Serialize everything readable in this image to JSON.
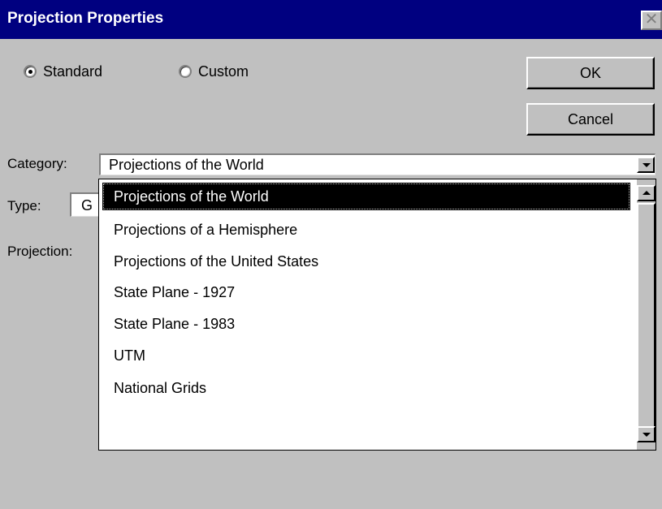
{
  "window": {
    "title": "Projection Properties",
    "close_glyph": "✕"
  },
  "mode": {
    "options": [
      {
        "label": "Standard",
        "checked": true
      },
      {
        "label": "Custom",
        "checked": false
      }
    ]
  },
  "buttons": {
    "ok": "OK",
    "cancel": "Cancel"
  },
  "category": {
    "label": "Category:",
    "value": "Projections of the World",
    "options": [
      "Projections of the World",
      "Projections of a Hemisphere",
      "Projections of the United States",
      "State Plane - 1927",
      "State Plane - 1983",
      "UTM",
      "National Grids"
    ],
    "selected_index": 0
  },
  "type": {
    "label": "Type:",
    "value": "G"
  },
  "projection": {
    "label": "Projection:"
  },
  "icons": {
    "close": "close-icon",
    "dropdown_arrow": "chevron-down-icon",
    "scroll_up": "scroll-up-icon",
    "scroll_down": "scroll-down-icon"
  },
  "colors": {
    "titlebar": "#000080",
    "dialog": "#c0c0c0",
    "selection": "#000000"
  }
}
